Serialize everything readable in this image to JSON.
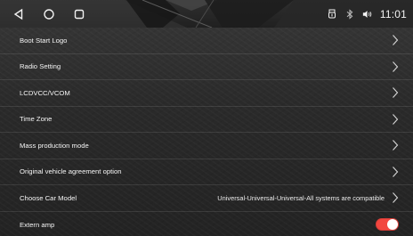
{
  "status_bar": {
    "nav": [
      {
        "name": "back-icon"
      },
      {
        "name": "home-icon"
      },
      {
        "name": "recent-apps-icon"
      }
    ],
    "icons": [
      "usb-icon",
      "bluetooth-icon",
      "volume-icon"
    ],
    "time": "11:01"
  },
  "settings": {
    "items": [
      {
        "label": "Boot Start Logo",
        "value": "",
        "control": "chevron"
      },
      {
        "label": "Radio Setting",
        "value": "",
        "control": "chevron"
      },
      {
        "label": "LCDVCC/VCOM",
        "value": "",
        "control": "chevron"
      },
      {
        "label": "Time Zone",
        "value": "",
        "control": "chevron"
      },
      {
        "label": "Mass production mode",
        "value": "",
        "control": "chevron"
      },
      {
        "label": "Original vehicle agreement option",
        "value": "",
        "control": "chevron"
      },
      {
        "label": "Choose Car Model",
        "value": "Universal-Universal-Universal-All systems are compatible",
        "control": "chevron"
      },
      {
        "label": "Extern amp",
        "value": "",
        "control": "toggle",
        "toggle_state": "on"
      }
    ]
  },
  "colors": {
    "background": "#2b2b2b",
    "status_bar": "#202020",
    "text": "#f5f5f5",
    "divider": "#3b3b3b",
    "toggle_on": "#f2463f",
    "chevron": "#d8d8d8"
  }
}
